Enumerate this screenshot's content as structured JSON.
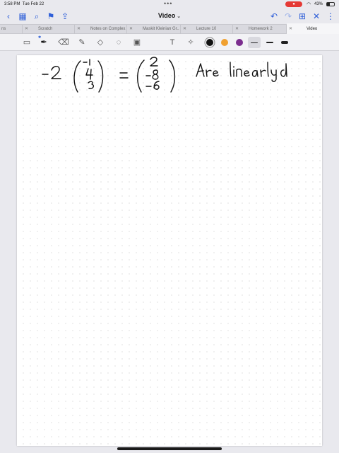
{
  "status_bar": {
    "time": "3:58 PM",
    "date": "Tue Feb 22",
    "battery_text": "43%",
    "battery_level": 0.43,
    "recording_color": "#e53935"
  },
  "nav": {
    "title": "Video",
    "accent": "#2f5fd8"
  },
  "tabs": [
    {
      "label": "ns",
      "active": false
    },
    {
      "label": "Scratch",
      "active": false
    },
    {
      "label": "Notes on Complex...",
      "active": false
    },
    {
      "label": "Maskit Kleinian Gr...",
      "active": false
    },
    {
      "label": "Lecture 10",
      "active": false
    },
    {
      "label": "Homework 2",
      "active": false
    },
    {
      "label": "Video",
      "active": true
    }
  ],
  "toolbar": {
    "tools": [
      "lasso-view-icon",
      "pen-icon",
      "eraser-icon",
      "highlighter-icon",
      "shapes-icon",
      "lasso-icon",
      "image-icon",
      "text-icon",
      "laser-pointer-icon"
    ],
    "colors": [
      "#111111",
      "#f0a030",
      "#7b2d8e"
    ],
    "selected_color": "#111111",
    "selected_width": "thin"
  }
}
